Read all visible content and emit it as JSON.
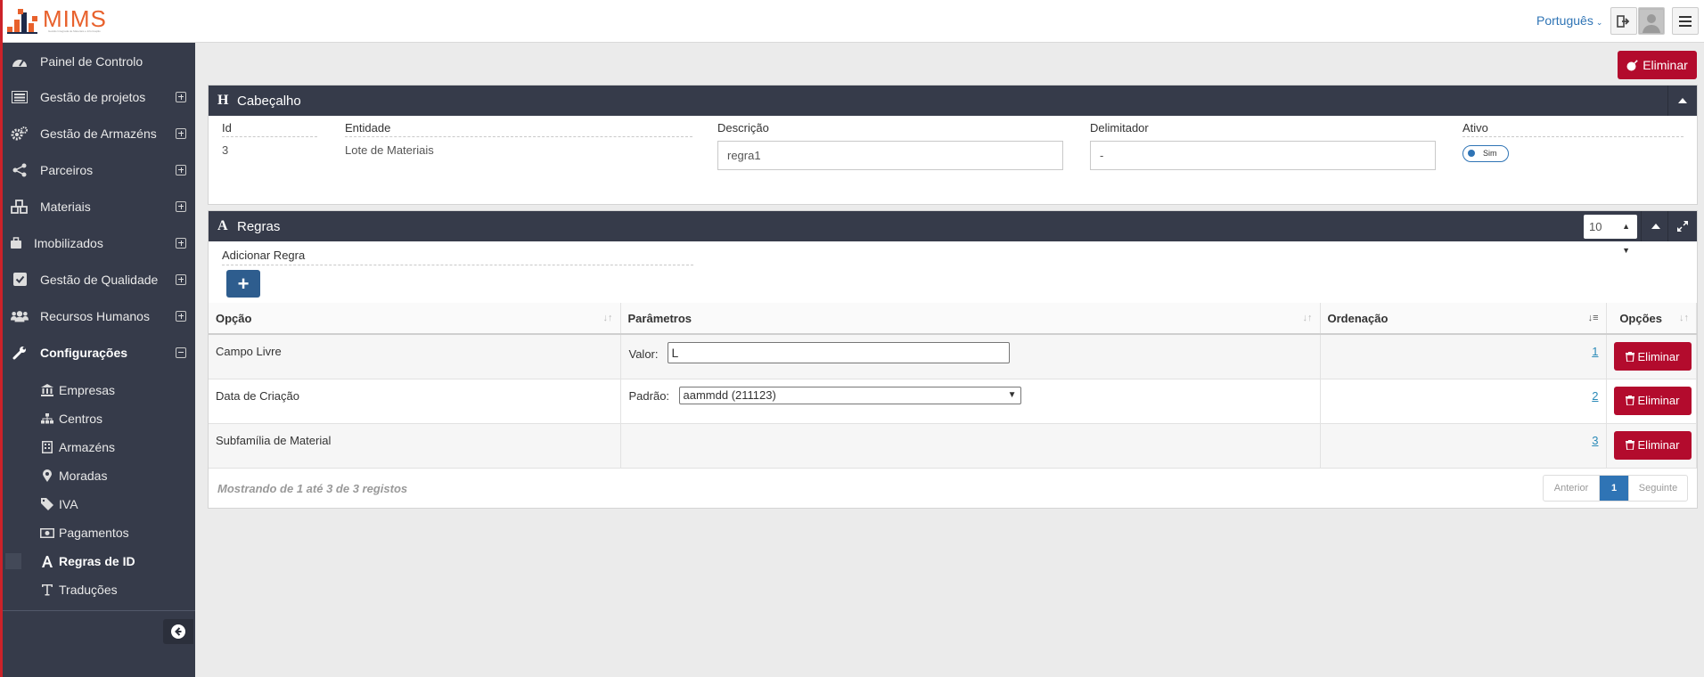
{
  "app": {
    "logo_text": "MIMS",
    "logo_subtitle": "Gestão Integrada de Materiais e Informação"
  },
  "topbar": {
    "language": "Português"
  },
  "sidebar": {
    "items": [
      {
        "label": "Painel de Controlo",
        "icon": "dashboard-icon"
      },
      {
        "label": "Gestão de projetos",
        "icon": "list-icon"
      },
      {
        "label": "Gestão de Armazéns",
        "icon": "cogs-icon"
      },
      {
        "label": "Parceiros",
        "icon": "share-icon"
      },
      {
        "label": "Materiais",
        "icon": "cubes-icon"
      },
      {
        "label": "Imobilizados",
        "icon": "briefcase-icon"
      },
      {
        "label": "Gestão de Qualidade",
        "icon": "check-square-icon"
      },
      {
        "label": "Recursos Humanos",
        "icon": "users-icon"
      },
      {
        "label": "Configurações",
        "icon": "wrench-icon"
      }
    ],
    "subitems": [
      {
        "label": "Empresas",
        "icon": "bank-icon"
      },
      {
        "label": "Centros",
        "icon": "sitemap-icon"
      },
      {
        "label": "Armazéns",
        "icon": "building-icon"
      },
      {
        "label": "Moradas",
        "icon": "map-marker-icon"
      },
      {
        "label": "IVA",
        "icon": "tag-icon"
      },
      {
        "label": "Pagamentos",
        "icon": "money-icon"
      },
      {
        "label": "Regras de ID",
        "icon": "font-icon"
      },
      {
        "label": "Traduções",
        "icon": "text-height-icon"
      }
    ]
  },
  "actions": {
    "delete_label": "Eliminar"
  },
  "header_panel": {
    "icon_letter": "H",
    "title": "Cabeçalho",
    "fields": {
      "id_label": "Id",
      "id_value": "3",
      "entity_label": "Entidade",
      "entity_value": "Lote de Materiais",
      "description_label": "Descrição",
      "description_value": "regra1",
      "delimiter_label": "Delimitador",
      "delimiter_value": "-",
      "active_label": "Ativo",
      "active_value": "Sim"
    }
  },
  "rules_panel": {
    "icon_letter": "A",
    "title": "Regras",
    "page_size": "10",
    "add_label": "Adicionar Regra",
    "add_button": "+",
    "columns": [
      "Opção",
      "Parâmetros",
      "Ordenação",
      "Opções"
    ],
    "rows": [
      {
        "option": "Campo Livre",
        "param_label": "Valor:",
        "param_value": "L",
        "order": "1",
        "delete": "Eliminar"
      },
      {
        "option": "Data de Criação",
        "param_label": "Padrão:",
        "param_value": "aammdd (211123)",
        "order": "2",
        "delete": "Eliminar"
      },
      {
        "option": "Subfamília de Material",
        "param_label": "",
        "param_value": "",
        "order": "3",
        "delete": "Eliminar"
      }
    ],
    "footer_info": "Mostrando de 1 até 3 de 3 registos",
    "pager": {
      "prev": "Anterior",
      "current": "1",
      "next": "Seguinte"
    }
  },
  "colors": {
    "sidebar_bg": "#363b4a",
    "danger": "#b30b2d",
    "primary": "#2f74b5",
    "brand": "#e8612c"
  }
}
